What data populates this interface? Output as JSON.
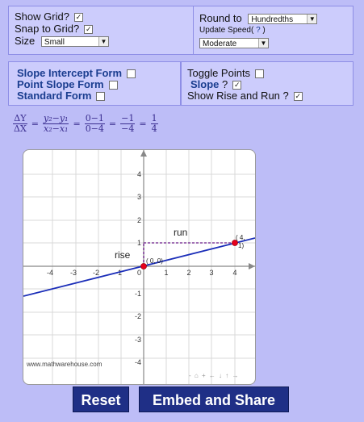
{
  "settings": {
    "show_grid_label": "Show Grid?",
    "show_grid_checked": true,
    "snap_grid_label": "Snap to Grid?",
    "snap_grid_checked": true,
    "size_label": "Size",
    "size_value": "Small",
    "round_label": "Round to",
    "round_value": "Hundredths",
    "update_speed_label": "Update Speed(",
    "update_speed_help": "?",
    "update_speed_close": ")",
    "update_speed_value": "Moderate"
  },
  "forms": {
    "slope_intercept_label": "Slope Intercept Form",
    "slope_intercept_checked": false,
    "point_slope_label": "Point Slope Form",
    "point_slope_checked": false,
    "standard_label": "Standard Form",
    "standard_checked": false
  },
  "toggles": {
    "toggle_points_label": "Toggle Points",
    "toggle_points_checked": false,
    "slope_label": "Slope",
    "slope_q": "?",
    "slope_checked": true,
    "rise_run_label": "Show Rise and Run ?",
    "rise_run_checked": true
  },
  "formula": {
    "dy": "ΔY",
    "dx": "ΔX",
    "y_diff": "y₂−y₁",
    "x_diff": "x₂−x₁",
    "n1": "0−1",
    "d1": "0−4",
    "n2": "−1",
    "d2": "−4",
    "n3": "1",
    "d3": "4"
  },
  "graph": {
    "watermark": "www.mathwarehouse.com",
    "rise_label": "rise",
    "run_label": "run",
    "point_a_label": "( 0, 0)",
    "point_b_label_1": "( 4,",
    "point_b_label_2": "1)",
    "toolbar": "- ⌂ + ← ↓ ↑ →",
    "x_ticks": [
      "-4",
      "-3",
      "-2",
      "-1",
      "0",
      "1",
      "2",
      "3",
      "4"
    ],
    "y_ticks": [
      "4",
      "3",
      "2",
      "1",
      "-1",
      "-2",
      "-3",
      "-4"
    ],
    "line_color": "#1a2db8",
    "point_color": "#e8001c"
  },
  "buttons": {
    "reset": "Reset",
    "embed": "Embed and Share"
  }
}
